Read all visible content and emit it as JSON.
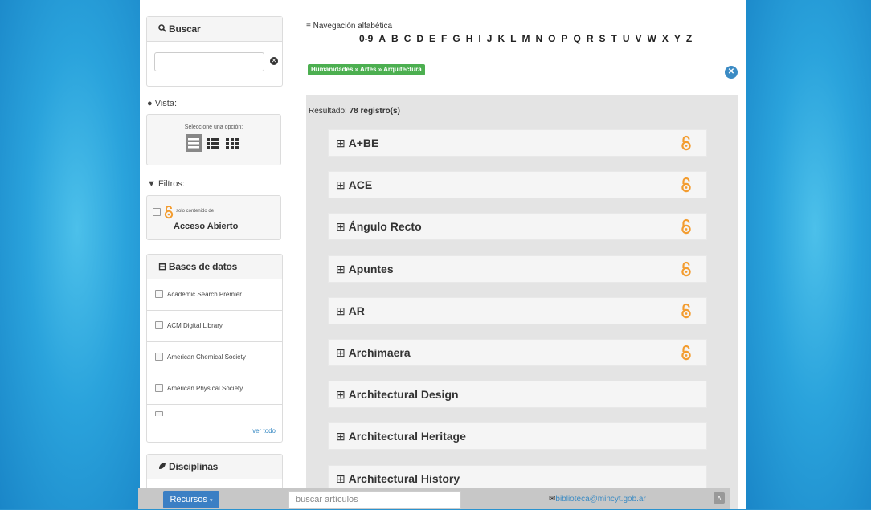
{
  "search": {
    "title": "Buscar",
    "value": ""
  },
  "vista": {
    "label": "Vista:",
    "hint": "Seleccione una opción:"
  },
  "filtros": {
    "label": "Filtros:",
    "oa_small": "solo contenido de",
    "oa_big": "Acceso Abierto"
  },
  "databases": {
    "title": "Bases de datos",
    "items": [
      "Academic Search Premier",
      "ACM Digital Library",
      "American Chemical Society",
      "American Physical Society",
      ""
    ],
    "more": "ver todo"
  },
  "disciplinas": {
    "title": "Disciplinas"
  },
  "nav": {
    "title": "Navegación alfabética",
    "letters": [
      "0-9",
      "A",
      "B",
      "C",
      "D",
      "E",
      "F",
      "G",
      "H",
      "I",
      "J",
      "K",
      "L",
      "M",
      "N",
      "O",
      "P",
      "Q",
      "R",
      "S",
      "T",
      "U",
      "V",
      "W",
      "X",
      "Y",
      "Z"
    ]
  },
  "breadcrumb": "Humanidades » Artes » Arquitectura",
  "results": {
    "label": "Resultado:",
    "count": "78 registro(s)",
    "items": [
      {
        "title": "A+BE",
        "open_access": true
      },
      {
        "title": "ACE",
        "open_access": true
      },
      {
        "title": "Ángulo Recto",
        "open_access": true
      },
      {
        "title": "Apuntes",
        "open_access": true
      },
      {
        "title": "AR",
        "open_access": true
      },
      {
        "title": "Archimaera",
        "open_access": true
      },
      {
        "title": "Architectural Design",
        "open_access": false
      },
      {
        "title": "Architectural Heritage",
        "open_access": false
      },
      {
        "title": "Architectural History",
        "open_access": false
      }
    ]
  },
  "footer": {
    "recursos": "Recursos",
    "search_placeholder": "buscar artículos",
    "email": "biblioteca@mincyt.gob.ar"
  },
  "colors": {
    "accent": "#3b8bc4",
    "oa_orange": "#f39c2f",
    "crumb_green": "#4caf50"
  }
}
